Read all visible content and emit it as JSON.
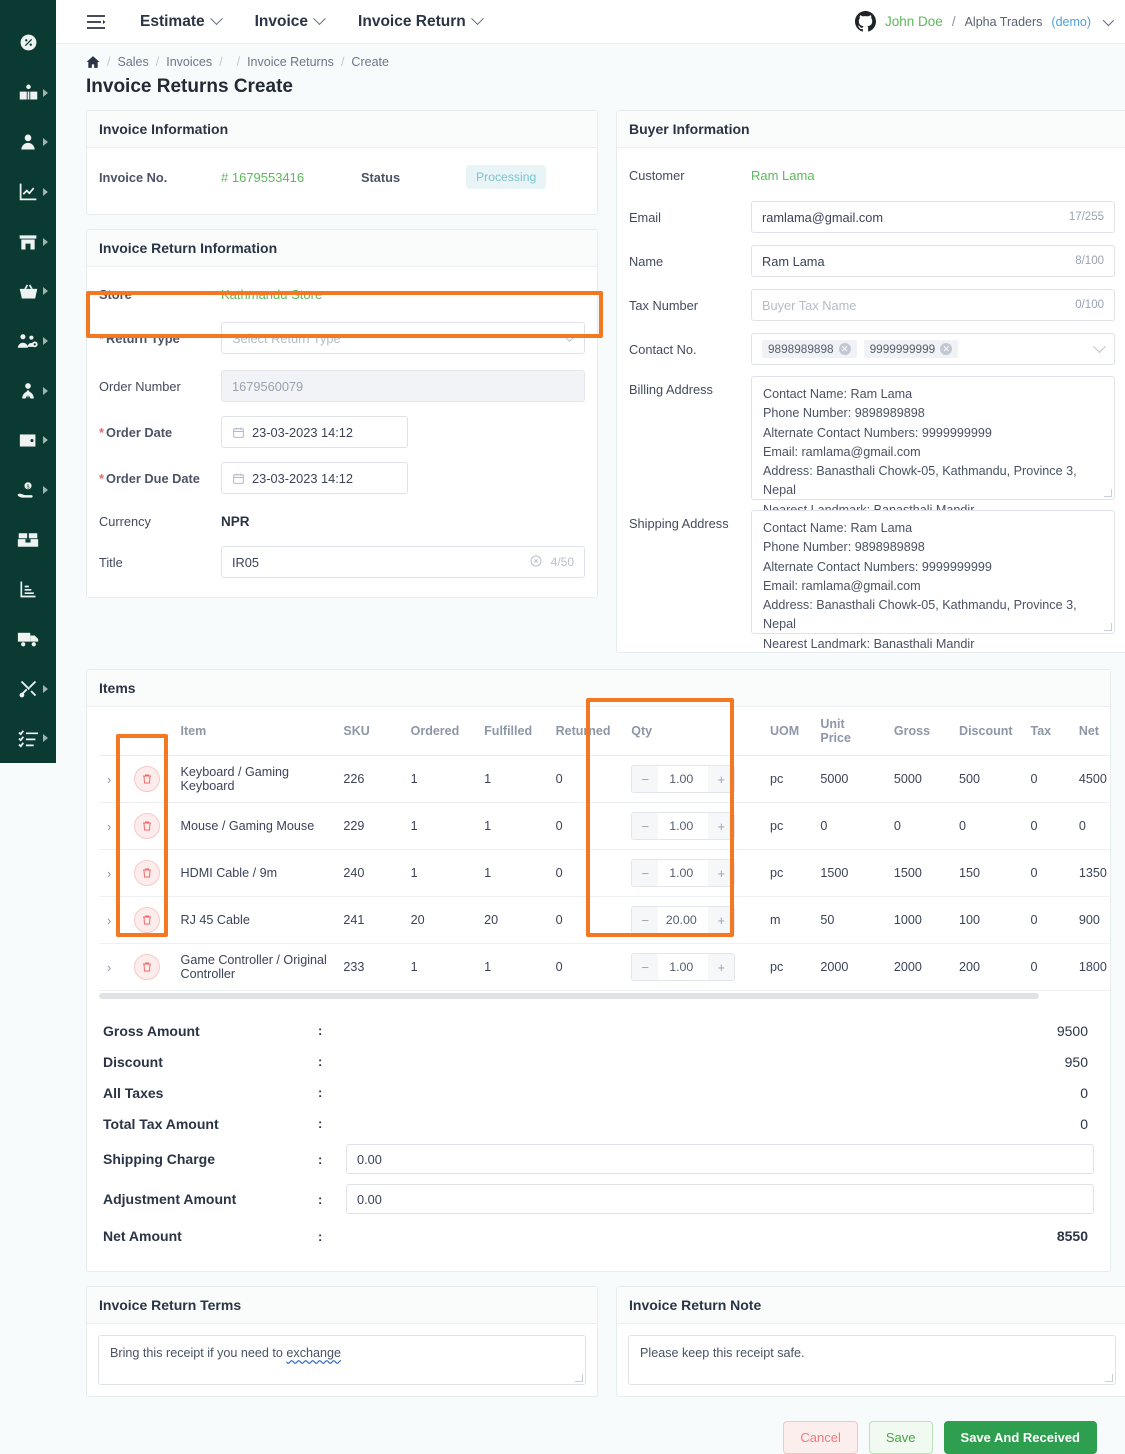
{
  "sidebar": {
    "items": [
      {
        "name": "dashboard",
        "icon": "dashboard-icon",
        "caret": false
      },
      {
        "name": "catalog",
        "icon": "book-user-icon",
        "caret": true
      },
      {
        "name": "customer",
        "icon": "user-icon",
        "caret": true
      },
      {
        "name": "analytics",
        "icon": "chart-line-icon",
        "caret": true
      },
      {
        "name": "store",
        "icon": "store-icon",
        "caret": true
      },
      {
        "name": "sales",
        "icon": "basket-icon",
        "caret": true
      },
      {
        "name": "team",
        "icon": "users-cog-icon",
        "caret": true
      },
      {
        "name": "hr",
        "icon": "user-tie-icon",
        "caret": true
      },
      {
        "name": "wallet",
        "icon": "wallet-icon",
        "caret": true
      },
      {
        "name": "payment",
        "icon": "hand-money-icon",
        "caret": true
      },
      {
        "name": "inventory",
        "icon": "boxes-icon",
        "caret": false
      },
      {
        "name": "reports",
        "icon": "bar-chart-icon",
        "caret": false
      },
      {
        "name": "delivery",
        "icon": "truck-icon",
        "caret": false
      },
      {
        "name": "tools",
        "icon": "tools-icon",
        "caret": true
      },
      {
        "name": "tasks",
        "icon": "checklist-icon",
        "caret": true
      }
    ]
  },
  "topbar": {
    "menu_icon": "hamburger-icon",
    "nav": [
      {
        "label": "Estimate"
      },
      {
        "label": "Invoice"
      },
      {
        "label": "Invoice Return"
      }
    ],
    "user": {
      "avatar_icon": "github-octocat-icon",
      "name": "John Doe",
      "separator": "/",
      "org": "Alpha Traders",
      "mode": "(demo)"
    }
  },
  "breadcrumb": {
    "home_icon": "home-icon",
    "items": [
      "Sales",
      "Invoices",
      "",
      "Invoice Returns",
      "Create"
    ]
  },
  "page": {
    "title": "Invoice Returns Create"
  },
  "invoice_information": {
    "header": "Invoice Information",
    "invoice_no_label": "Invoice No.",
    "invoice_no_value": "# 1679553416",
    "status_label": "Status",
    "status_value": "Processing",
    "status_bg": "#e9f4f6",
    "status_fg": "#78c5cf"
  },
  "invoice_return_information": {
    "header": "Invoice Return Information",
    "store_label": "Store",
    "store_value": "Kathmandu Store",
    "return_type_label": "Return Type",
    "return_type_required": "*",
    "return_type_placeholder": "Select Return Type",
    "order_number_label": "Order Number",
    "order_number_value": "1679560079",
    "order_date_label": "Order Date",
    "order_date_required": "*",
    "order_date_value": "23-03-2023 14:12",
    "order_due_date_label": "Order Due Date",
    "order_due_date_required": "*",
    "order_due_date_value": "23-03-2023 14:12",
    "currency_label": "Currency",
    "currency_value": "NPR",
    "title_label": "Title",
    "title_value": "IR05",
    "title_counter": "4/50"
  },
  "buyer_information": {
    "header": "Buyer Information",
    "customer_label": "Customer",
    "customer_value": "Ram Lama",
    "email_label": "Email",
    "email_value": "ramlama@gmail.com",
    "email_counter": "17/255",
    "name_label": "Name",
    "name_value": "Ram Lama",
    "name_counter": "8/100",
    "tax_number_label": "Tax Number",
    "tax_number_placeholder": "Buyer Tax Name",
    "tax_number_counter": "0/100",
    "contact_no_label": "Contact No.",
    "contact_tags": [
      "9898989898",
      "9999999999"
    ],
    "billing_address_label": "Billing Address",
    "billing_address_value": "Contact Name: Ram Lama\nPhone Number: 9898989898\nAlternate Contact Numbers: 9999999999\nEmail: ramlama@gmail.com\nAddress: Banasthali Chowk-05, Kathmandu, Province 3, Nepal\nNearest Landmark: Banasthali Mandir",
    "shipping_address_label": "Shipping Address",
    "shipping_address_value": "Contact Name: Ram Lama\nPhone Number: 9898989898\nAlternate Contact Numbers: 9999999999\nEmail: ramlama@gmail.com\nAddress: Banasthali Chowk-05, Kathmandu, Province 3, Nepal\nNearest Landmark: Banasthali Mandir"
  },
  "items": {
    "header": "Items",
    "columns": [
      "",
      "",
      "Item",
      "SKU",
      "Ordered",
      "Fulfilled",
      "Returned",
      "Qty",
      "UOM",
      "Unit Price",
      "Gross",
      "Discount",
      "Tax",
      "Net"
    ],
    "rows": [
      {
        "item": "Keyboard / Gaming Keyboard",
        "sku": "226",
        "ordered": "1",
        "fulfilled": "1",
        "returned": "0",
        "qty": "1.00",
        "uom": "pc",
        "unit_price": "5000",
        "gross": "5000",
        "discount": "500",
        "tax": "0",
        "net": "4500"
      },
      {
        "item": "Mouse / Gaming Mouse",
        "sku": "229",
        "ordered": "1",
        "fulfilled": "1",
        "returned": "0",
        "qty": "1.00",
        "uom": "pc",
        "unit_price": "0",
        "gross": "0",
        "discount": "0",
        "tax": "0",
        "net": "0"
      },
      {
        "item": "HDMI Cable / 9m",
        "sku": "240",
        "ordered": "1",
        "fulfilled": "1",
        "returned": "0",
        "qty": "1.00",
        "uom": "pc",
        "unit_price": "1500",
        "gross": "1500",
        "discount": "150",
        "tax": "0",
        "net": "1350"
      },
      {
        "item": "RJ 45 Cable",
        "sku": "241",
        "ordered": "20",
        "fulfilled": "20",
        "returned": "0",
        "qty": "20.00",
        "uom": "m",
        "unit_price": "50",
        "gross": "1000",
        "discount": "100",
        "tax": "0",
        "net": "900"
      },
      {
        "item": "Game Controller / Original Controller",
        "sku": "233",
        "ordered": "1",
        "fulfilled": "1",
        "returned": "0",
        "qty": "1.00",
        "uom": "pc",
        "unit_price": "2000",
        "gross": "2000",
        "discount": "200",
        "tax": "0",
        "net": "1800"
      }
    ],
    "expand_icon": "chevron-right-icon",
    "delete_icon": "trash-icon",
    "minus": "−",
    "plus": "+"
  },
  "totals": {
    "colon": ":",
    "rows": [
      {
        "label": "Gross Amount",
        "value": "9500",
        "type": "text"
      },
      {
        "label": "Discount",
        "value": "950",
        "type": "text"
      },
      {
        "label": "All Taxes",
        "value": "0",
        "type": "text"
      },
      {
        "label": "Total Tax Amount",
        "value": "0",
        "type": "text"
      },
      {
        "label": "Shipping Charge",
        "value": "0.00",
        "type": "input"
      },
      {
        "label": "Adjustment Amount",
        "value": "0.00",
        "type": "input"
      },
      {
        "label": "Net Amount",
        "value": "8550",
        "type": "bold"
      }
    ]
  },
  "terms": {
    "header": "Invoice Return Terms",
    "value_pre": "Bring this receipt if you need to ",
    "value_link": "exchange"
  },
  "note": {
    "header": "Invoice Return Note",
    "value": "Please keep this receipt safe."
  },
  "footer_buttons": {
    "cancel": "Cancel",
    "save": "Save",
    "save_and_received": "Save And Received"
  },
  "highlight_color": "#f47721"
}
